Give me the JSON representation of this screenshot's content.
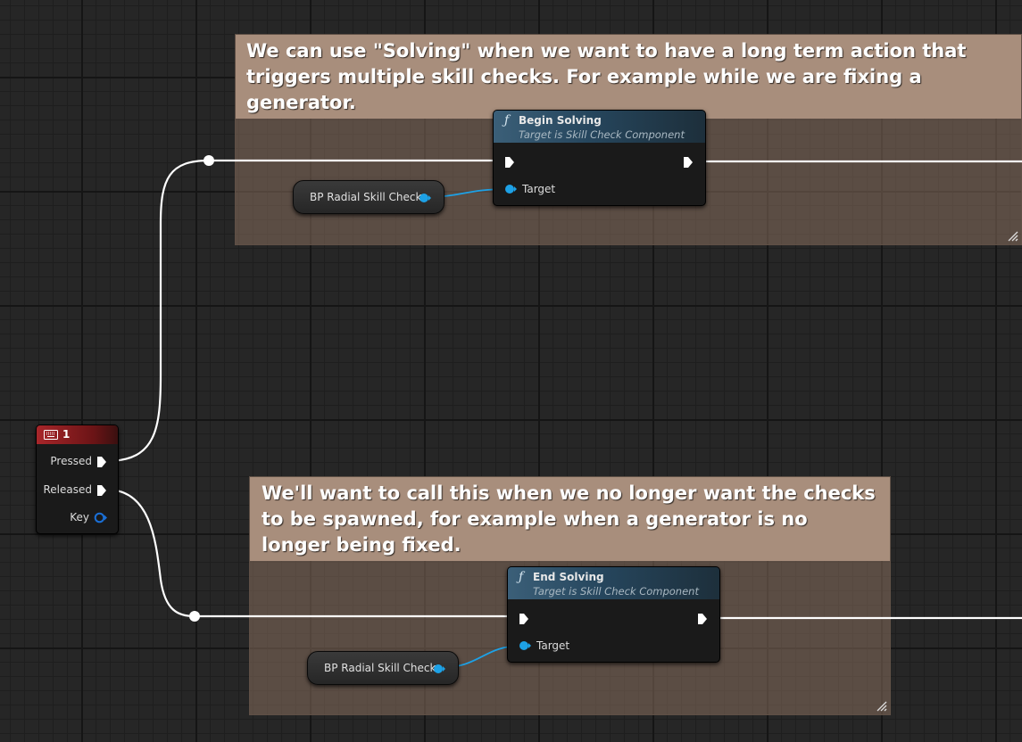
{
  "comments": [
    {
      "text": "We can use \"Solving\" when we want to have a long term action that triggers multiple skill checks. For example while we are fixing a generator."
    },
    {
      "text": "We'll want to call this when we no longer want the checks to be spawned, for example when a generator is no longer being fixed."
    }
  ],
  "input_node": {
    "key": "1",
    "icon": "keyboard-icon",
    "pins": {
      "pressed": "Pressed",
      "released": "Released",
      "key": "Key"
    }
  },
  "function_nodes": [
    {
      "title": "Begin Solving",
      "subtitle": "Target is Skill Check Component",
      "target_pin": "Target",
      "icon": "function-icon"
    },
    {
      "title": "End Solving",
      "subtitle": "Target is Skill Check Component",
      "target_pin": "Target",
      "icon": "function-icon"
    }
  ],
  "variable_nodes": [
    {
      "label": "BP Radial Skill Check"
    },
    {
      "label": "BP Radial Skill Check"
    }
  ],
  "colors": {
    "exec_wire": "#ffffff",
    "object_pin": "#1da1e6",
    "comment_header": "#a88e7c",
    "function_header": "#3b5f78",
    "input_header": "#a8262a"
  }
}
